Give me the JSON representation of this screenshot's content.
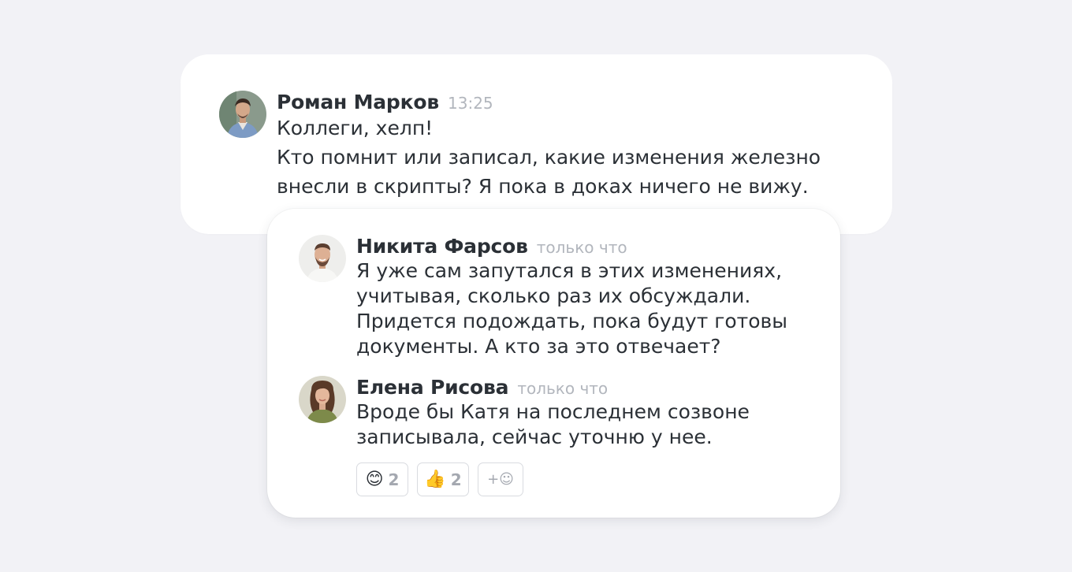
{
  "messages": [
    {
      "author": "Роман Марков",
      "time": "13:25",
      "lines": [
        "Коллеги, хелп!",
        "Кто помнит или записал, какие изменения железно",
        "внесли в скрипты? Я пока в доках ничего не вижу."
      ]
    },
    {
      "author": "Никита Фарсов",
      "time": "только что",
      "lines": [
        "Я уже сам запутался в этих изменениях,",
        "учитывая, сколько раз их обсуждали.",
        "Придется подождать, пока будут готовы",
        "документы. А кто за это отвечает?"
      ]
    },
    {
      "author": "Елена Рисова",
      "time": "только что",
      "lines": [
        "Вроде бы Катя на последнем созвоне",
        "записывала, сейчас уточню у нее."
      ]
    }
  ],
  "reactions": [
    {
      "emoji": "😊",
      "icon": "smiling-face-emoji",
      "count": "2"
    },
    {
      "emoji": "👍",
      "icon": "thumbs-up-emoji",
      "count": "2"
    }
  ],
  "add_reaction": {
    "label": "+☺",
    "icon": "add-reaction-icon"
  }
}
